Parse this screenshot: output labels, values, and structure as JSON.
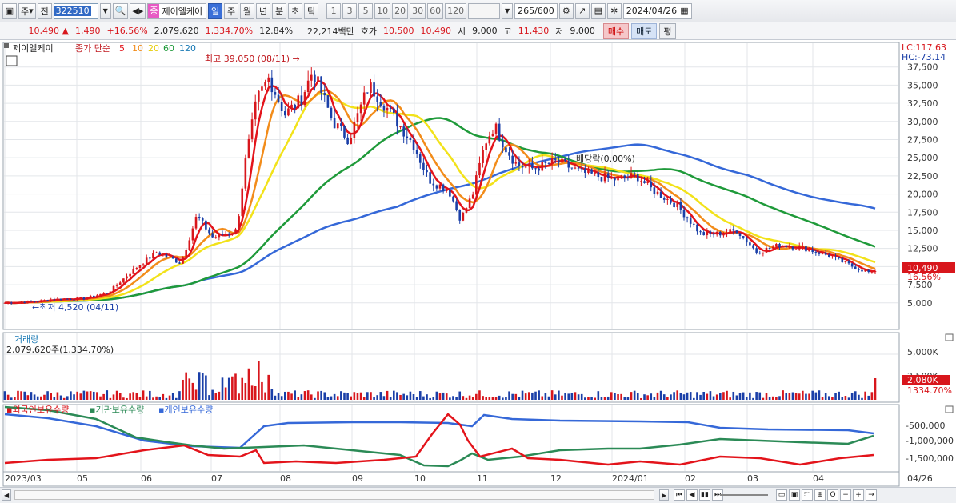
{
  "toolbar": {
    "market_label": "주",
    "prev_label": "전",
    "stock_code": "322510",
    "stock_name_tag": "종",
    "stock_name": "제이엘케이",
    "periods": [
      "일",
      "주",
      "월",
      "년",
      "분",
      "초",
      "틱"
    ],
    "active_period": "일",
    "numbers": [
      "1",
      "3",
      "5",
      "10",
      "20",
      "30",
      "60",
      "120"
    ],
    "count": "265",
    "count_total": "/600",
    "date": "2024/04/26"
  },
  "quote": {
    "price": "10,490",
    "arrow": "▲",
    "change": "1,490",
    "change_pct": "+16.56%",
    "volume": "2,079,620",
    "vol_pct": "1,334.70%",
    "turnover_pct": "12.84%",
    "amount": "22,214백만",
    "hoga_label": "호가",
    "ask": "10,500",
    "bid": "10,490",
    "open_label": "시",
    "open": "9,000",
    "high_label": "고",
    "high": "11,430",
    "low_label": "저",
    "low": "9,000",
    "buy_label": "매수",
    "sell_label": "매도",
    "avg_label": "평"
  },
  "price_panel": {
    "stock_tag": "제이엘케이",
    "ma_title": "종가 단순",
    "ma_periods": [
      "5",
      "10",
      "20",
      "60",
      "120"
    ],
    "high_annotation": "최고 39,050 (08/11) →",
    "low_annotation": "←최저 4,520 (04/11)",
    "dividend_annotation": "배당락(0.00%)",
    "lc_label": "LC:117.63",
    "hc_label": "HC:-73.14",
    "y_ticks": [
      "37,500",
      "35,000",
      "32,500",
      "30,000",
      "27,500",
      "25,000",
      "22,500",
      "20,000",
      "17,500",
      "15,000",
      "12,500",
      "10,000",
      "7,500",
      "5,000"
    ],
    "price_tag": "10,490",
    "pct_tag": "16.56%"
  },
  "volume_panel": {
    "title": "거래량",
    "value": "2,079,620주(1,334.70%)",
    "y_ticks": [
      "5,000K",
      "2,500K"
    ],
    "vol_tag": "2,080K",
    "vol_pct_tag": "1334.70%"
  },
  "holdings_panel": {
    "legend": [
      "외국인보유수량",
      "기관보유수량",
      "개인보유수량"
    ],
    "y_ticks": [
      "-500,000",
      "-1,000,000",
      "-1,500,000"
    ]
  },
  "x_axis": {
    "labels": [
      "2023/03",
      "05",
      "06",
      "07",
      "08",
      "09",
      "10",
      "11",
      "12",
      "2024/01",
      "02",
      "03",
      "04"
    ],
    "end_label": "04/26"
  },
  "colors": {
    "up": "#d8161c",
    "down": "#1a3fa8",
    "ma5": "#e3141b",
    "ma10": "#f28c1a",
    "ma20": "#f2e21a",
    "ma60": "#1f9a3a",
    "ma120": "#3568d8",
    "foreign": "#e3141b",
    "institution": "#2b8a56",
    "individual": "#3568d8"
  }
}
